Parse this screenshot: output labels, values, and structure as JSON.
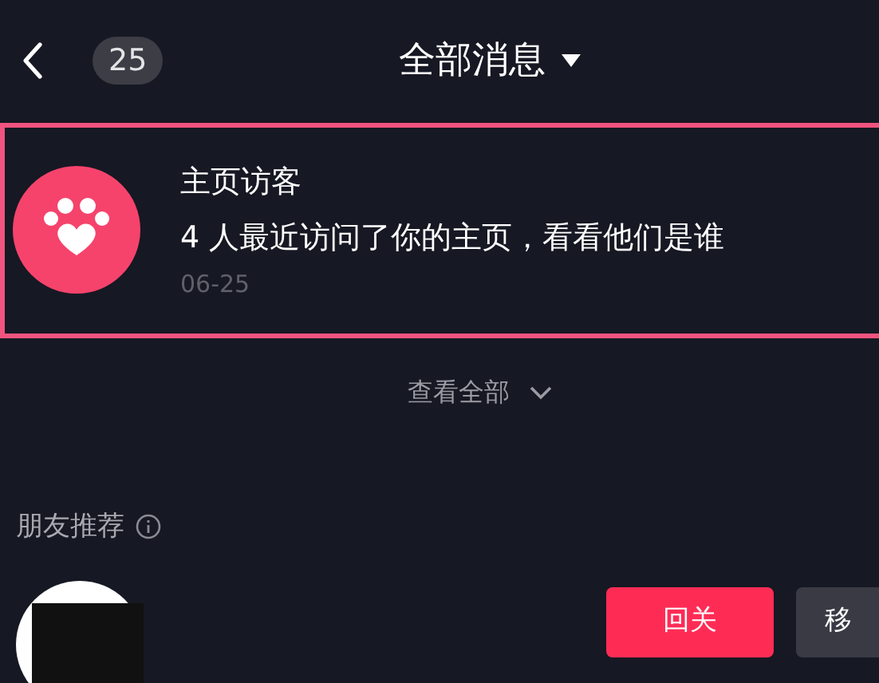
{
  "header": {
    "count": "25",
    "title": "全部消息"
  },
  "notification": {
    "title": "主页访客",
    "message": "4 人最近访问了你的主页，看看他们是谁",
    "date": "06-25",
    "highlighted": true
  },
  "view_all": "查看全部",
  "section": {
    "title": "朋友推荐"
  },
  "recommendation": {
    "buttons": [
      {
        "label": "回关",
        "kind": "primary"
      },
      {
        "label": "移",
        "kind": "secondary"
      }
    ]
  }
}
